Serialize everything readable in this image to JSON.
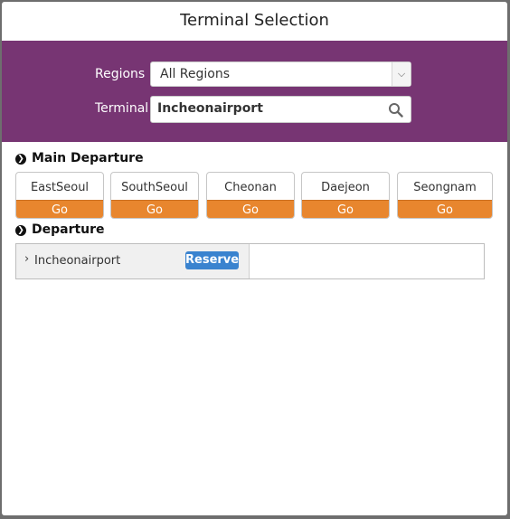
{
  "dialog": {
    "title": "Terminal Selection"
  },
  "filter": {
    "regions_label": "Regions",
    "regions_value": "All Regions",
    "terminal_label": "Terminal",
    "terminal_value": "Incheonairport"
  },
  "main_departure": {
    "heading": "Main Departure",
    "terminals": [
      {
        "name": "EastSeoul",
        "go_label": "Go"
      },
      {
        "name": "SouthSeoul",
        "go_label": "Go"
      },
      {
        "name": "Cheonan",
        "go_label": "Go"
      },
      {
        "name": "Daejeon",
        "go_label": "Go"
      },
      {
        "name": "Seongnam",
        "go_label": "Go"
      }
    ]
  },
  "departure": {
    "heading": "Departure",
    "rows": [
      {
        "name": "Incheonairport",
        "action_label": "Reserve"
      }
    ]
  },
  "colors": {
    "header_bg": "#773573",
    "go_button": "#e8862e",
    "reserve_button": "#3a83cf"
  },
  "icons": {
    "search": "magnifier-icon",
    "select": "chevron-down-icon",
    "section": "circle-chevron-right-icon",
    "row": "chevron-right-icon"
  }
}
